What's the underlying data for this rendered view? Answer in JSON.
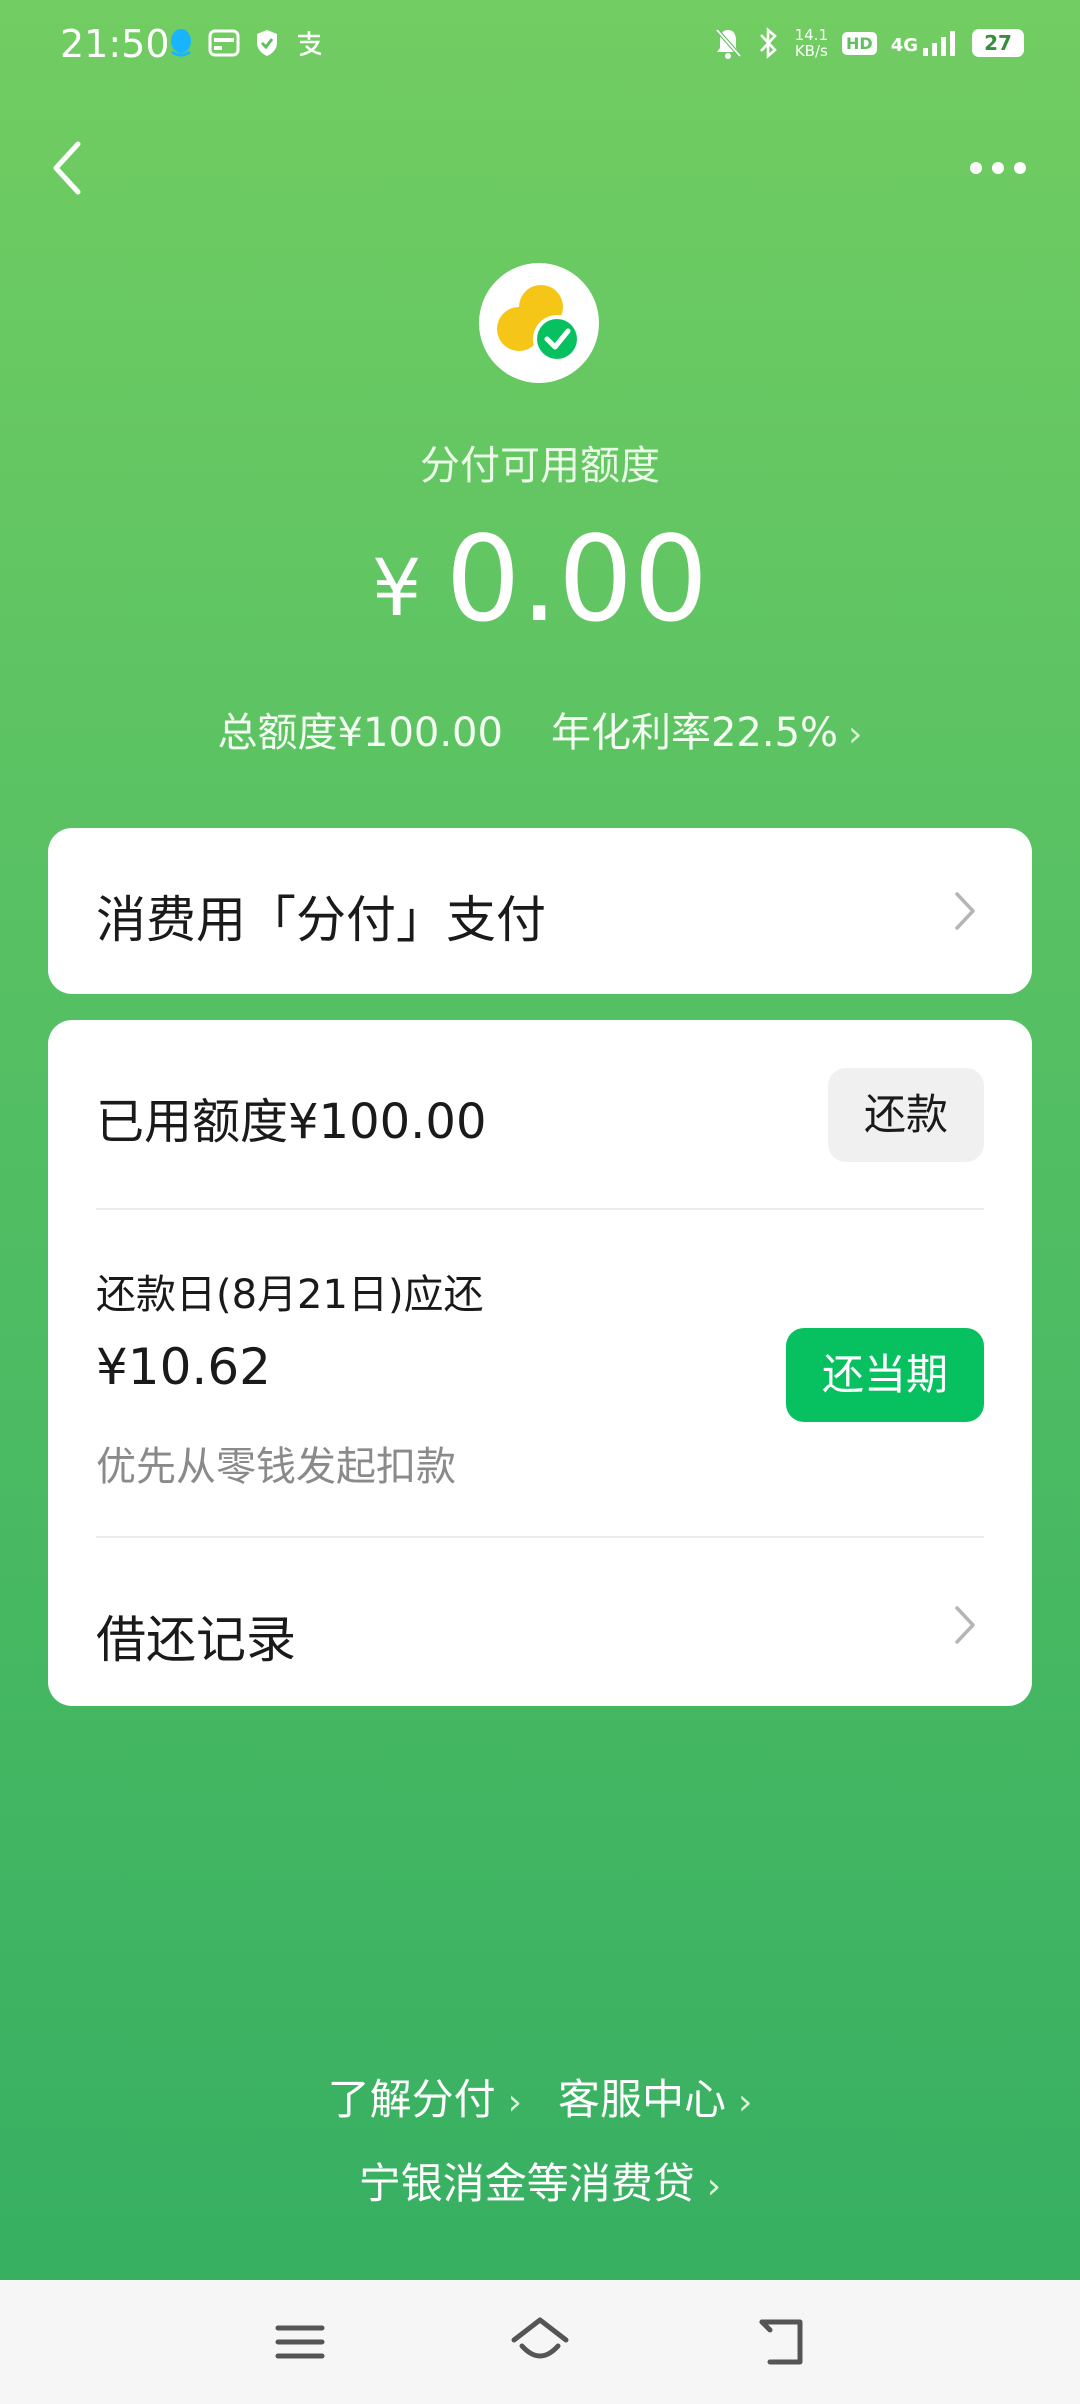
{
  "status_bar": {
    "time": "21:50",
    "net_speed_value": "14.1",
    "net_speed_unit": "KB/s",
    "hd_label": "HD",
    "network": "4G",
    "battery": "27"
  },
  "header": {
    "credit_label": "分付可用额度",
    "currency_symbol": "¥",
    "available_amount": "0.00",
    "total_credit": "总额度¥100.00",
    "annual_rate": "年化利率22.5%"
  },
  "pay_card": {
    "label": "消费用「分付」支付"
  },
  "loan_card": {
    "used_credit": "已用额度¥100.00",
    "repay_button": "还款",
    "due_label": "还款日(8月21日)应还",
    "due_amount": "¥10.62",
    "repay_now_button": "还当期",
    "deduction_note": "优先从零钱发起扣款",
    "records_label": "借还记录"
  },
  "footer_links": {
    "learn": "了解分付",
    "service": "客服中心",
    "lenders": "宁银消金等消费贷"
  },
  "colors": {
    "brand_green": "#07c160",
    "bg_top": "#72cd62",
    "bg_bottom": "#34ae62",
    "logo_yellow": "#f5c518"
  }
}
